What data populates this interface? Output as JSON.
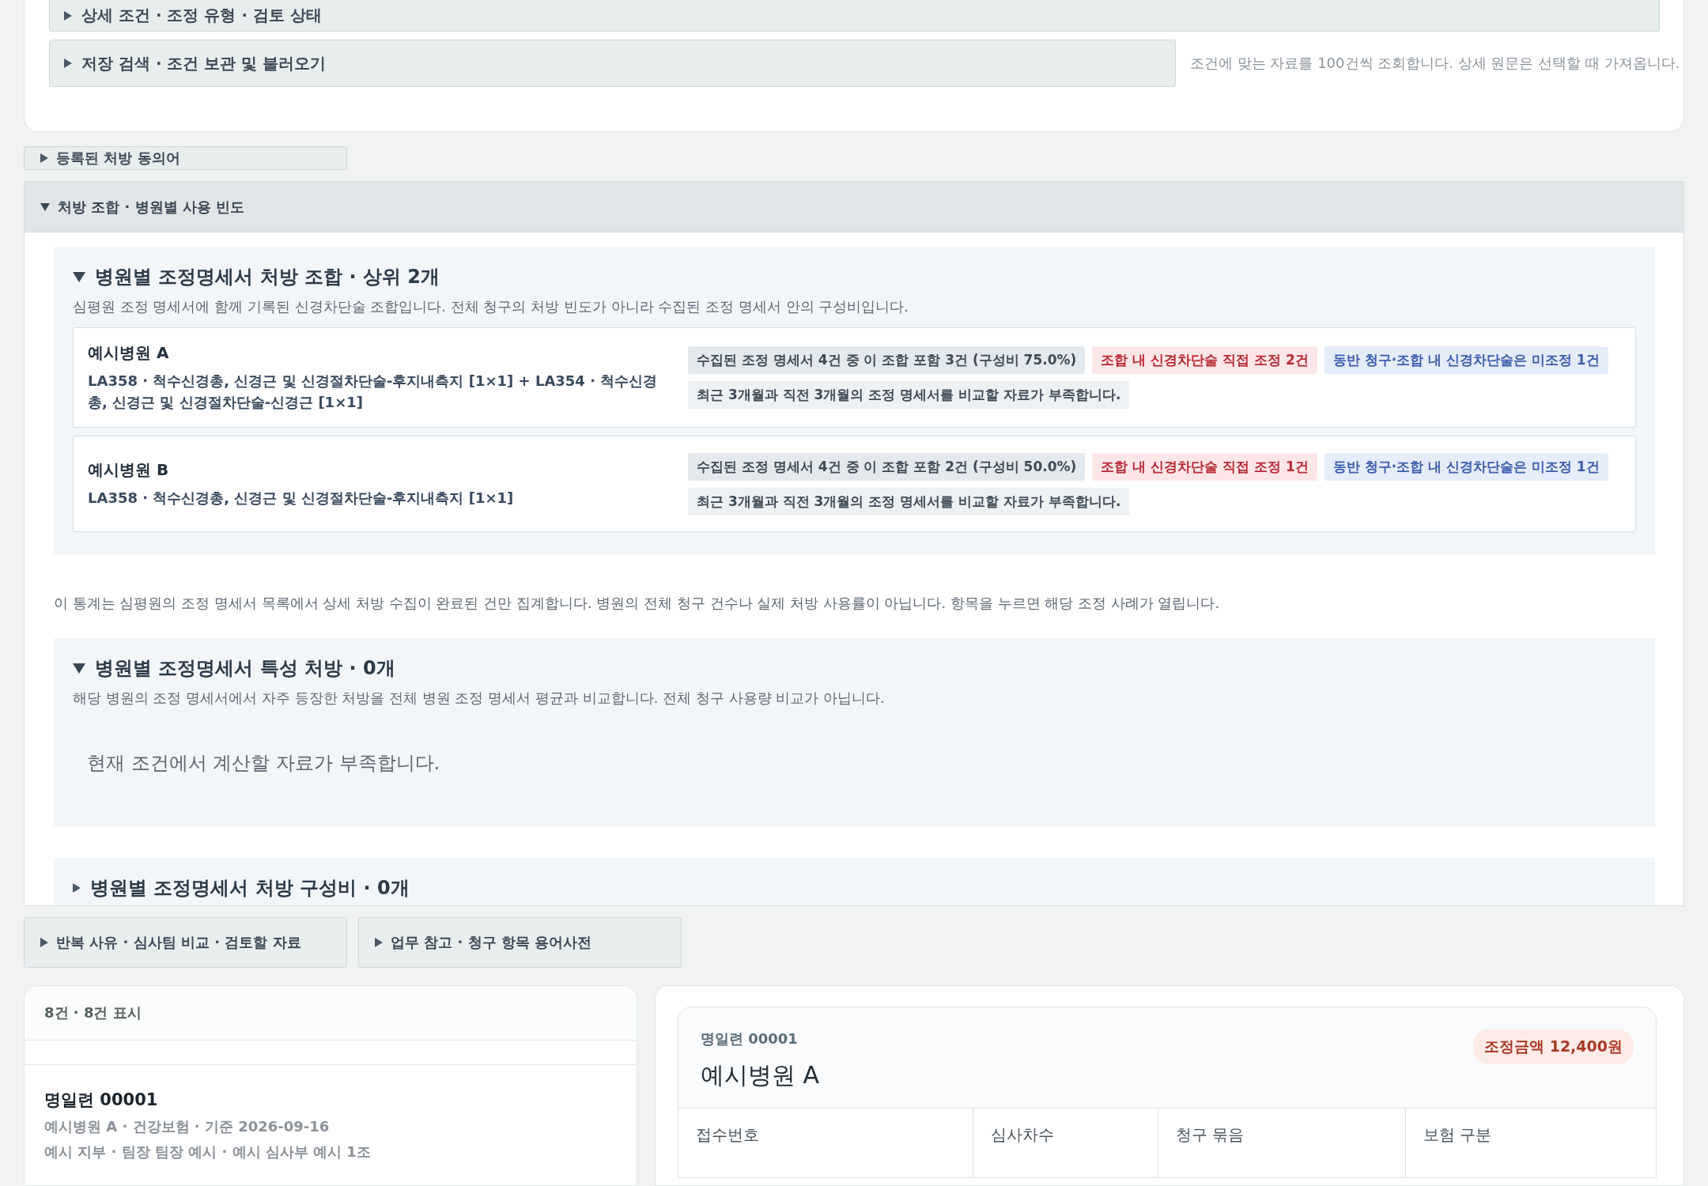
{
  "filters": {
    "sections": [
      {
        "label": "상세 조건 · 조정 유형 · 검토 상태",
        "expanded": false
      },
      {
        "label": "저장 검색 · 조건 보관 및 불러오기",
        "expanded": false
      }
    ],
    "note": "조건에 맞는 자료를 100건씩 조회합니다. 상세 원문은 선택할 때 가져옵니다."
  },
  "synonyms": {
    "label": "등록된 처방 동의어",
    "expanded": false
  },
  "frequency": {
    "label": "처방 조합 · 병원별 사용 빈도",
    "expanded": true,
    "combinations": {
      "title": "병원별 조정명세서 처방 조합 · 상위 2개",
      "expanded": true,
      "description": "심평원 조정 명세서에 함께 기록된 신경차단술 조합입니다. 전체 청구의 처방 빈도가 아니라 수집된 조정 명세서 안의 구성비입니다.",
      "hospitals": [
        {
          "name": "예시병원 A",
          "combo": "LA358 · 척수신경총, 신경근 및 신경절차단술-후지내측지 [1×1] + LA354 · 척수신경총, 신경근 및 신경절차단술-신경근 [1×1]",
          "tags": [
            {
              "text": "수집된 조정 명세서 4건 중 이 조합 포함 3건 (구성비 75.0%)",
              "kind": "neutral"
            },
            {
              "text": "조합 내 신경차단술 직접 조정 2건",
              "kind": "danger"
            },
            {
              "text": "동반 청구·조합 내 신경차단술은 미조정 1건",
              "kind": "info"
            }
          ],
          "trend": "최근 3개월과 직전 3개월의 조정 명세서를 비교할 자료가 부족합니다."
        },
        {
          "name": "예시병원 B",
          "combo": "LA358 · 척수신경총, 신경근 및 신경절차단술-후지내측지 [1×1]",
          "tags": [
            {
              "text": "수집된 조정 명세서 4건 중 이 조합 포함 2건 (구성비 50.0%)",
              "kind": "neutral"
            },
            {
              "text": "조합 내 신경차단술 직접 조정 1건",
              "kind": "danger"
            },
            {
              "text": "동반 청구·조합 내 신경차단술은 미조정 1건",
              "kind": "info"
            }
          ],
          "trend": "최근 3개월과 직전 3개월의 조정 명세서를 비교할 자료가 부족합니다."
        }
      ]
    },
    "note": "이 통계는 심평원의 조정 명세서 목록에서 상세 처방 수집이 완료된 건만 집계합니다. 병원의 전체 청구 건수나 실제 처방 사용률이 아닙니다. 항목을 누르면 해당 조정 사례가 열립니다.",
    "characteristic": {
      "title": "병원별 조정명세서 특성 처방 · 0개",
      "expanded": true,
      "description": "해당 병원의 조정 명세서에서 자주 등장한 처방을 전체 병원 조정 명세서 평균과 비교합니다. 전체 청구 사용량 비교가 아닙니다.",
      "empty": "현재 조건에서 계산할 자료가 부족합니다."
    },
    "composition": {
      "title": "병원별 조정명세서 처방 구성비 · 0개",
      "expanded": false
    }
  },
  "tools": [
    {
      "label": "반복 사유 · 심사팀 비교 · 검토할 자료",
      "expanded": false
    },
    {
      "label": "업무 참고 · 청구 항목 용어사전",
      "expanded": false
    }
  ],
  "list": {
    "count": "8건 · 8건 표시",
    "items": [
      {
        "title": "명일련 00001",
        "meta": "예시병원 A · 건강보험 · 기준 2026-09-16",
        "sub": "예시 지부 · 팀장 팀장 예시 · 예시 심사부 예시 1조"
      }
    ]
  },
  "detail": {
    "serial": "명일련 00001",
    "hospital": "예시병원 A",
    "amount": "조정금액 12,400원",
    "fields": [
      {
        "label": "접수번호"
      },
      {
        "label": "심사차수"
      },
      {
        "label": "청구 묶음"
      },
      {
        "label": "보험 구분"
      }
    ]
  }
}
